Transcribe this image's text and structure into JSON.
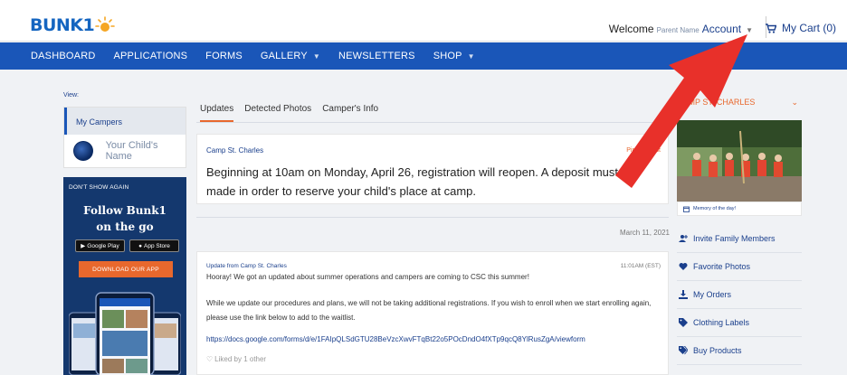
{
  "header": {
    "logo_text": "BUNK1",
    "welcome": "Welcome",
    "parent_name": "Parent Name",
    "account": "Account",
    "cart": "My Cart (0)"
  },
  "nav": {
    "items": [
      {
        "label": "DASHBOARD"
      },
      {
        "label": "APPLICATIONS"
      },
      {
        "label": "FORMS"
      },
      {
        "label": "GALLERY"
      },
      {
        "label": "NEWSLETTERS"
      },
      {
        "label": "SHOP"
      }
    ]
  },
  "left": {
    "view_label": "View:",
    "my_campers": "My Campers",
    "child_name": "Your Child's Name",
    "promo": {
      "dont_show": "DON'T SHOW AGAIN",
      "follow_line1": "Follow Bunk1",
      "follow_line2": "on the go",
      "google_play": "Google Play",
      "app_store": "App Store",
      "download": "DOWNLOAD OUR APP"
    }
  },
  "tabs": [
    {
      "label": "Updates"
    },
    {
      "label": "Detected Photos"
    },
    {
      "label": "Camper's Info"
    }
  ],
  "pinned_post": {
    "source": "Camp St. Charles",
    "badge": "Pinned Post",
    "message": "Beginning at 10am on Monday, April 26, registration will reopen. A deposit must be made in order to reserve your child's place at camp."
  },
  "feed": {
    "date": "March 11, 2021",
    "post": {
      "source": "Update from Camp St. Charles",
      "time": "11:01AM (EST)",
      "line1": "Hooray! We got an updated about summer operations and campers are coming to CSC this summer!",
      "line2": "While we update our procedures and plans, we will not be taking additional registrations. If you wish to enroll when we start enrolling again, please use the link below to add to the waitlist.",
      "link": "https://docs.google.com/forms/d/e/1FAIpQLSdGTU28BeVzcXwvFTqBt22o5POcDndO4fXTp9qcQ8YlRusZgA/viewform",
      "liked": "Liked by 1 other"
    }
  },
  "right": {
    "camp_name": "CAMP ST. CHARLES",
    "memory": "Memory of the day!",
    "links": [
      {
        "label": "Invite Family Members",
        "icon": "invite-user-icon"
      },
      {
        "label": "Favorite Photos",
        "icon": "heart-icon"
      },
      {
        "label": "My Orders",
        "icon": "download-icon"
      },
      {
        "label": "Clothing Labels",
        "icon": "tag-icon"
      },
      {
        "label": "Buy Products",
        "icon": "tags-icon"
      }
    ]
  },
  "colors": {
    "brand_blue": "#1a56b8",
    "accent_orange": "#e8682d",
    "annotation_red": "#e8302a"
  }
}
